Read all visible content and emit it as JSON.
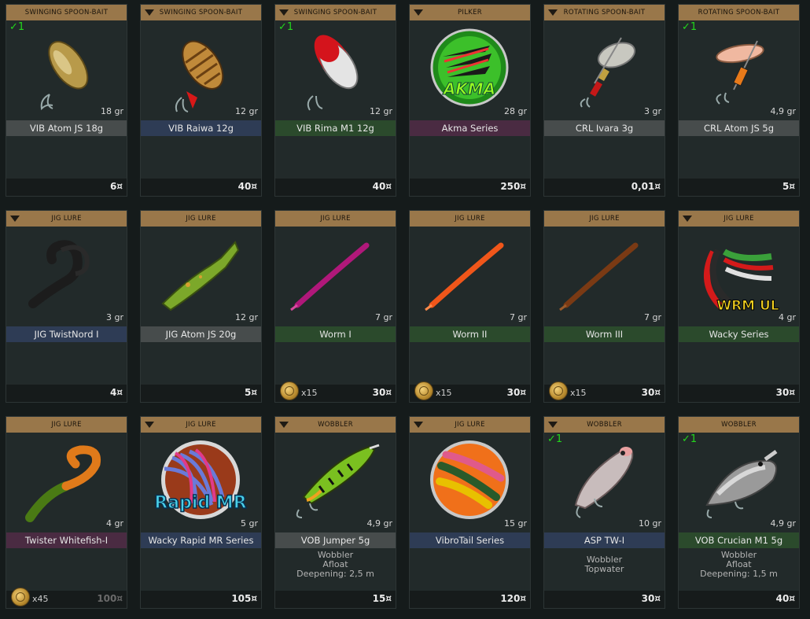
{
  "items": [
    {
      "category": "SWINGING SPOON-BAIT",
      "menu": false,
      "count": "✓1",
      "weight": "18 gr",
      "name": "VIB Atom JS 18g",
      "name_color": "gray",
      "desc": "",
      "bonus": "",
      "old_price": "",
      "price": "6¤",
      "icon": "spoon-gold-icon"
    },
    {
      "category": "SWINGING SPOON-BAIT",
      "menu": true,
      "count": "",
      "weight": "12 gr",
      "name": "VIB Raiwa 12g",
      "name_color": "blue",
      "desc": "",
      "bonus": "",
      "old_price": "",
      "price": "40¤",
      "icon": "spoon-scaled-icon"
    },
    {
      "category": "SWINGING SPOON-BAIT",
      "menu": true,
      "count": "✓1",
      "weight": "12 gr",
      "name": "VIB Rima M1 12g",
      "name_color": "green",
      "desc": "",
      "bonus": "",
      "old_price": "",
      "price": "40¤",
      "icon": "spoon-red-white-icon"
    },
    {
      "category": "PILKER",
      "menu": true,
      "count": "",
      "weight": "28 gr",
      "name": "Akma Series",
      "name_color": "purple",
      "desc": "",
      "bonus": "",
      "old_price": "",
      "price": "250¤",
      "icon": "akma-series-icon"
    },
    {
      "category": "ROTATING SPOON-BAIT",
      "menu": true,
      "count": "",
      "weight": "3 gr",
      "name": "CRL Ivara 3g",
      "name_color": "gray",
      "desc": "",
      "bonus": "",
      "old_price": "",
      "price": "0,01¤",
      "icon": "spinner-silver-icon"
    },
    {
      "category": "ROTATING SPOON-BAIT",
      "menu": false,
      "count": "✓1",
      "weight": "4,9 gr",
      "name": "CRL Atom JS 5g",
      "name_color": "gray",
      "desc": "",
      "bonus": "",
      "old_price": "",
      "price": "5¤",
      "icon": "spinner-orange-icon"
    },
    {
      "category": "JIG LURE",
      "menu": true,
      "count": "",
      "weight": "3 gr",
      "name": "JIG TwistNord I",
      "name_color": "blue",
      "desc": "",
      "bonus": "",
      "old_price": "",
      "price": "4¤",
      "icon": "twister-black-icon"
    },
    {
      "category": "JIG LURE",
      "menu": false,
      "count": "",
      "weight": "12 gr",
      "name": "JIG Atom JS 20g",
      "name_color": "gray",
      "desc": "",
      "bonus": "",
      "old_price": "",
      "price": "5¤",
      "icon": "shad-green-icon"
    },
    {
      "category": "JIG LURE",
      "menu": false,
      "count": "",
      "weight": "7 gr",
      "name": "Worm I",
      "name_color": "green",
      "desc": "",
      "bonus": "x15",
      "old_price": "",
      "price": "30¤",
      "icon": "worm-purple-icon"
    },
    {
      "category": "JIG LURE",
      "menu": false,
      "count": "",
      "weight": "7 gr",
      "name": "Worm II",
      "name_color": "green",
      "desc": "",
      "bonus": "x15",
      "old_price": "",
      "price": "30¤",
      "icon": "worm-orange-icon"
    },
    {
      "category": "JIG LURE",
      "menu": false,
      "count": "",
      "weight": "7 gr",
      "name": "Worm III",
      "name_color": "green",
      "desc": "",
      "bonus": "x15",
      "old_price": "",
      "price": "30¤",
      "icon": "worm-brown-icon"
    },
    {
      "category": "JIG LURE",
      "menu": true,
      "count": "",
      "weight": "4 gr",
      "name": "Wacky Series",
      "name_color": "green",
      "desc": "",
      "bonus": "",
      "old_price": "",
      "price": "30¤",
      "icon": "wrm-ul-series-icon"
    },
    {
      "category": "JIG LURE",
      "menu": false,
      "count": "",
      "weight": "4 gr",
      "name": "Twister Whitefish-I",
      "name_color": "purple",
      "desc": "",
      "bonus": "x45",
      "old_price": "100¤",
      "price": "",
      "icon": "twister-orange-green-icon"
    },
    {
      "category": "JIG LURE",
      "menu": true,
      "count": "",
      "weight": "5 gr",
      "name": "Wacky Rapid MR Series",
      "name_color": "blue",
      "desc": "",
      "bonus": "",
      "old_price": "",
      "price": "105¤",
      "icon": "rapid-mr-series-icon"
    },
    {
      "category": "WOBBLER",
      "menu": true,
      "count": "",
      "weight": "4,9 gr",
      "name": "VOB Jumper 5g",
      "name_color": "gray",
      "desc": "Wobbler\nAfloat\nDeepening: 2,5 m",
      "bonus": "",
      "old_price": "",
      "price": "15¤",
      "icon": "wobbler-firetiger-icon"
    },
    {
      "category": "JIG LURE",
      "menu": true,
      "count": "",
      "weight": "15 gr",
      "name": "VibroTail Series",
      "name_color": "blue",
      "desc": "",
      "bonus": "",
      "old_price": "",
      "price": "120¤",
      "icon": "vibrotail-series-icon"
    },
    {
      "category": "WOBBLER",
      "menu": true,
      "count": "✓1",
      "weight": "10 gr",
      "name": "ASP TW-I",
      "name_color": "blue",
      "desc": "Wobbler\nTopwater",
      "bonus": "",
      "old_price": "",
      "price": "30¤",
      "icon": "wobbler-popper-icon"
    },
    {
      "category": "WOBBLER",
      "menu": false,
      "count": "✓1",
      "weight": "4,9 gr",
      "name": "VOB Crucian M1 5g",
      "name_color": "green",
      "desc": "Wobbler\nAfloat\nDeepening: 1,5 m",
      "bonus": "",
      "old_price": "",
      "price": "40¤",
      "icon": "wobbler-crucian-icon"
    }
  ]
}
